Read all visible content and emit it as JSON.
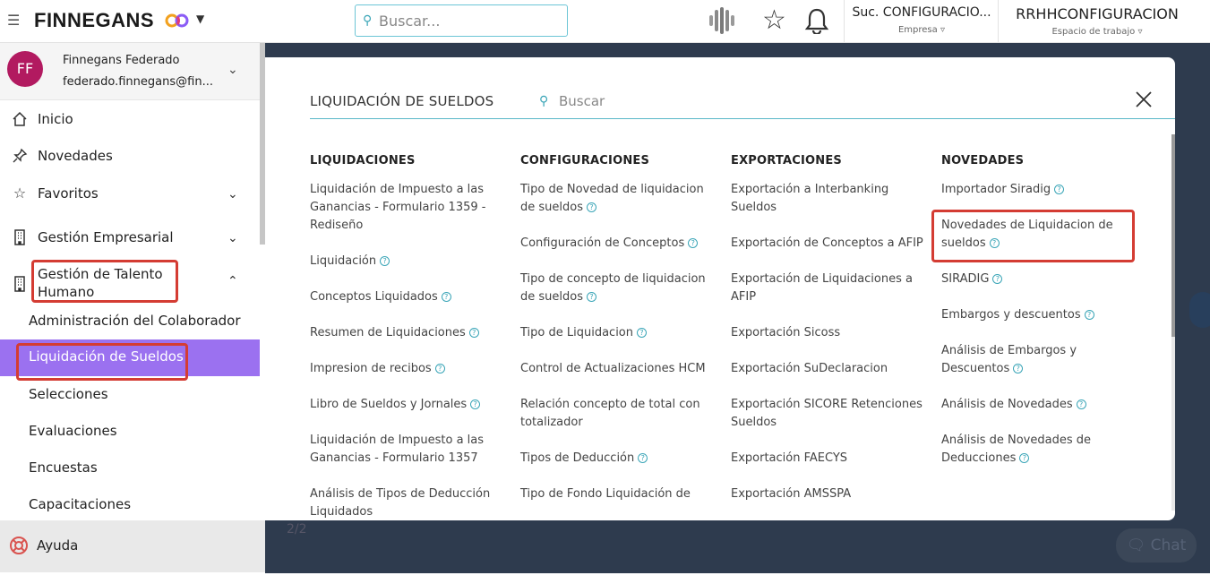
{
  "topbar": {
    "menu_icon": "hamburger-icon",
    "brand": "FINNEGANS",
    "search_placeholder": "Buscar...",
    "empresa_value": "Suc. CONFIGURACIO...",
    "empresa_label": "Empresa",
    "workspace_value": "RRHHCONFIGURACION",
    "workspace_label": "Espacio de trabajo"
  },
  "user": {
    "initials": "FF",
    "name": "Finnegans Federado",
    "email": "federado.finnegans@fin..."
  },
  "sidebar": {
    "items": [
      {
        "label": "Inicio",
        "icon": "home-icon"
      },
      {
        "label": "Novedades",
        "icon": "pin-icon"
      },
      {
        "label": "Favoritos",
        "icon": "star-icon"
      },
      {
        "label": "Gestión Empresarial",
        "icon": "building-icon"
      },
      {
        "label": "Gestión de Talento Humano",
        "icon": "building-icon"
      }
    ],
    "subitems": [
      "Administración del Colaborador",
      "Liquidación de Sueldos",
      "Selecciones",
      "Evaluaciones",
      "Encuestas",
      "Capacitaciones"
    ],
    "help": "Ayuda"
  },
  "backdrop": {
    "pager": "2/2",
    "chat": "Chat"
  },
  "modal": {
    "title": "LIQUIDACIÓN DE SUELDOS",
    "search_placeholder": "Buscar",
    "columns": [
      {
        "header": "LIQUIDACIONES",
        "links": [
          "Liquidación de Impuesto a las Ganancias - Formulario 1359 - Rediseño",
          "Liquidación",
          "Conceptos Liquidados",
          "Resumen de Liquidaciones",
          "Impresion de recibos",
          "Libro de Sueldos y Jornales",
          "Liquidación de Impuesto a las Ganancias - Formulario 1357",
          "Análisis de Tipos de Deducción Liquidados"
        ]
      },
      {
        "header": "CONFIGURACIONES",
        "links": [
          "Tipo de Novedad de liquidacion de sueldos",
          "Configuración de Conceptos",
          "Tipo de concepto de liquidacion de sueldos",
          "Tipo de Liquidacion",
          "Control de Actualizaciones HCM",
          "Relación concepto de total con totalizador",
          "Tipos de Deducción",
          "Tipo de Fondo Liquidación de"
        ]
      },
      {
        "header": "EXPORTACIONES",
        "links": [
          "Exportación a Interbanking Sueldos",
          "Exportación de Conceptos a AFIP",
          "Exportación de Liquidaciones a AFIP",
          "Exportación Sicoss",
          "Exportación SuDeclaracion",
          "Exportación SICORE Retenciones Sueldos",
          "Exportación FAECYS",
          "Exportación AMSSPA"
        ]
      },
      {
        "header": "NOVEDADES",
        "links": [
          "Importador Siradig",
          "Novedades de Liquidacion de sueldos",
          "SIRADIG",
          "Embargos y descuentos",
          "Análisis de Embargos y Descuentos",
          "Análisis de Novedades",
          "Análisis de Novedades de Deducciones"
        ]
      }
    ]
  },
  "colors": {
    "accent": "#9b71f0",
    "highlight": "#d43c33",
    "teal": "#3aa5b7",
    "backdrop": "#2e3b4e"
  }
}
